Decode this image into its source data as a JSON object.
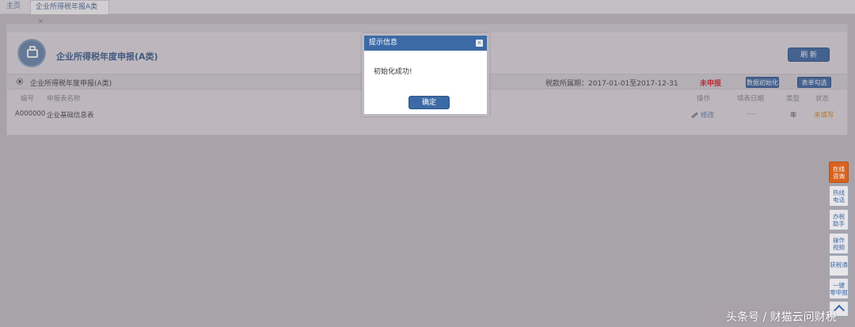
{
  "tabs": {
    "home": "主页",
    "active": "企业所得税年报A类",
    "close": "×"
  },
  "panel": {
    "title": "企业所得税年度申报(A类)",
    "refresh": "刷 新",
    "sub_label": "企业所得税年度申报(A类)",
    "period": "税款所属期：2017-01-01至2017-12-31",
    "status": "未申报",
    "init_btn": "数据初始化",
    "check_btn": "表单勾选"
  },
  "table": {
    "headers": {
      "code": "编号",
      "name": "申报表名称",
      "op": "操作",
      "date": "填表日期",
      "type": "类型",
      "state": "状态"
    },
    "rows": [
      {
        "code": "A000000",
        "name": "企业基础信息表",
        "op": "修改",
        "date": "----",
        "type": "年",
        "state": "未填写"
      }
    ]
  },
  "dialog": {
    "title": "提示信息",
    "close": "×",
    "message": "初始化成功!",
    "ok": "确定"
  },
  "side_buttons": [
    {
      "label": "在线\n咨询",
      "active": true
    },
    {
      "label": "热线\n电话",
      "active": false
    },
    {
      "label": "办税\n助手",
      "active": false
    },
    {
      "label": "操作\n视频",
      "active": false
    },
    {
      "label": "获税通",
      "active": false
    },
    {
      "label": "一键\n零申报",
      "active": false
    }
  ],
  "watermark": "头条号 / 财猫云问财税",
  "colors": {
    "accent": "#3c6aa6",
    "status_red": "#d8262a",
    "state_orange": "#d98a1f",
    "side_active": "#d8621e"
  }
}
